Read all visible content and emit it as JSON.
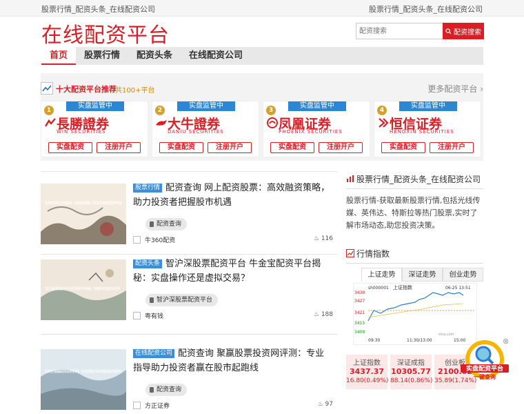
{
  "topbar": {
    "left": "股票行情_配资头条_在线配资公司",
    "right": "股票行情_配资头条_在线配资公司"
  },
  "logo": "在线配资平台",
  "search": {
    "placeholder": "配资搜索",
    "button": "配资搜索"
  },
  "nav": [
    "首页",
    "股票行情",
    "配资头条",
    "在线配资公司"
  ],
  "recommend": {
    "title": "十大配资平台推荐",
    "count": "共100+平台",
    "more": "更多配资平台",
    "cards": [
      {
        "rank": "1",
        "tag": "实盘监管中",
        "name": "長勝證券",
        "en": "WIN SECURITIES",
        "btn1": "实盘配资",
        "btn2": "注册开户"
      },
      {
        "rank": "2",
        "tag": "实盘监管中",
        "name": "大牛證券",
        "en": "DANIU SECURITIES",
        "btn1": "实盘配资",
        "btn2": "注册开户"
      },
      {
        "rank": "3",
        "tag": "实盘监管中",
        "name": "凤凰证券",
        "en": "PHOENIX SECURITIES",
        "btn1": "实盘配资",
        "btn2": "注册开户"
      },
      {
        "rank": "4",
        "tag": "实盘监管中",
        "name": "恒信证券",
        "en": "HENGXIN SECURITIES",
        "btn1": "实盘配资",
        "btn2": "注册开户"
      }
    ]
  },
  "articles": [
    {
      "category": "股票行情",
      "title": "配资查询 网上配资股票：高效融资策略，助力投资者把握股市机遇",
      "thumb_text": "配资查询 网上配资股票：高效融资策略，助力投资者把握股市机遇",
      "tag": "配资查询",
      "author": "牛360配资",
      "views": "116"
    },
    {
      "category": "配资头条",
      "title": "智沪深股票配资平台 牛金宝配资平台揭秘：实盘操作还是虚拟交易？",
      "thumb_text": "智沪深股票配资平台 牛金宝配资平台揭秘：实盘操作还是虚拟交易？",
      "tag": "智沪深股票配资平台",
      "author": "粤有钱",
      "views": "188"
    },
    {
      "category": "在线配资公司",
      "title": "配资查询 聚赢股票投资网评测：专业指导助力投资者赢在股市起跑线",
      "thumb_text": "配资查询 聚赢股票投资网评测：专业指导助力投资者赢在股市起跑线",
      "tag": "配资查询",
      "author": "方正证券",
      "views": "97"
    }
  ],
  "sidebar": {
    "title": "股票行情_配资头条_在线配资公司",
    "desc": "股票行情-获取最新股票行情,包括光线传媒、英伟达、特斯拉等热门股票,实时了解市场动态,助您投资决策。",
    "market_title": "行情指数",
    "tabs": [
      "上证走势",
      "深证走势",
      "创业走势"
    ],
    "chart": {
      "code": "sh000001",
      "name": "上证指数",
      "date": "06-25 13:51",
      "y": [
        "3430",
        "3427",
        "3421",
        "3415",
        "3409",
        "3403"
      ],
      "x": [
        "09:30",
        "11:30/13:00",
        "15:00"
      ],
      "source": "sina.com"
    },
    "indices": [
      {
        "name": "上证指数",
        "value": "3437.37",
        "change": "16.80(0.49%)"
      },
      {
        "name": "深证成指",
        "value": "10305.77",
        "change": "88.14(0.86%)"
      },
      {
        "name": "创业板",
        "value": "2100.02",
        "change": "35.89(1.74%)"
      }
    ]
  },
  "float_badge": {
    "line1": "实盘配资平台",
    "line2": "一键查询"
  }
}
